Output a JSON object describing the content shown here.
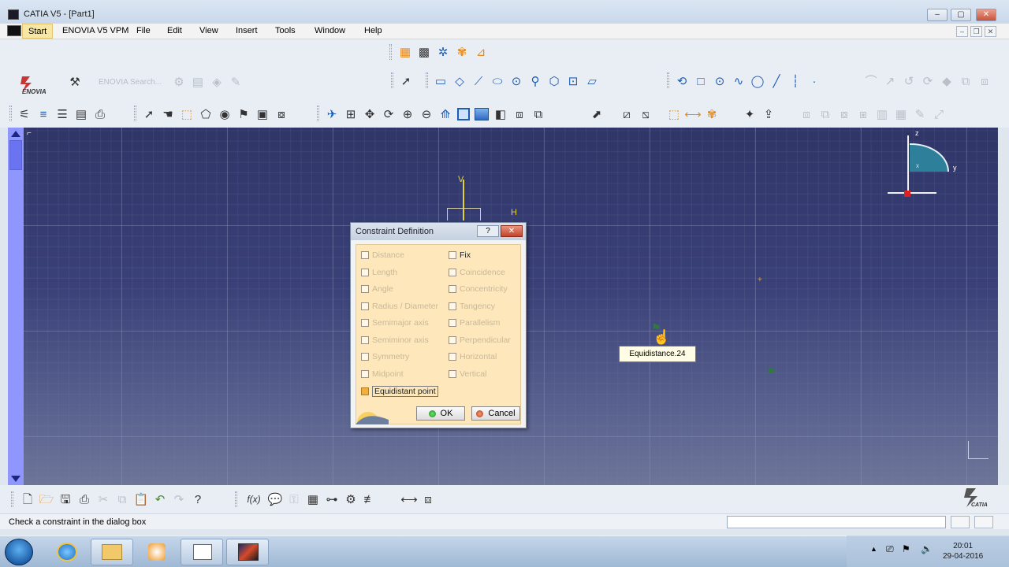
{
  "window": {
    "title": "CATIA V5 - [Part1]",
    "controls": [
      "minimize",
      "maximize",
      "close"
    ]
  },
  "menu": {
    "items": [
      "Start",
      "ENOVIA V5 VPM",
      "File",
      "Edit",
      "View",
      "Insert",
      "Tools",
      "Window",
      "Help"
    ]
  },
  "toolbar": {
    "enovia_logo_text": "ENOVIA",
    "enovia_search": "ENOVIA Search..."
  },
  "viewport": {
    "background": "#3a4178",
    "grid": true,
    "axis_labels": {
      "v": "V",
      "h": "H",
      "z": "z",
      "y": "y",
      "x": "x"
    }
  },
  "dialog": {
    "title": "Constraint Definition",
    "help": "?",
    "left_options": [
      {
        "label": "Distance",
        "enabled": false,
        "checked": false
      },
      {
        "label": "Length",
        "enabled": false,
        "checked": false
      },
      {
        "label": "Angle",
        "enabled": false,
        "checked": false
      },
      {
        "label": "Radius / Diameter",
        "enabled": false,
        "checked": false
      },
      {
        "label": "Semimajor axis",
        "enabled": false,
        "checked": false
      },
      {
        "label": "Semiminor axis",
        "enabled": false,
        "checked": false
      },
      {
        "label": "Symmetry",
        "enabled": false,
        "checked": false
      },
      {
        "label": "Midpoint",
        "enabled": false,
        "checked": false
      },
      {
        "label": "Equidistant point",
        "enabled": true,
        "checked": true
      }
    ],
    "right_options": [
      {
        "label": "Fix",
        "enabled": true,
        "checked": false
      },
      {
        "label": "Coincidence",
        "enabled": false,
        "checked": false
      },
      {
        "label": "Concentricity",
        "enabled": false,
        "checked": false
      },
      {
        "label": "Tangency",
        "enabled": false,
        "checked": false
      },
      {
        "label": "Parallelism",
        "enabled": false,
        "checked": false
      },
      {
        "label": "Perpendicular",
        "enabled": false,
        "checked": false
      },
      {
        "label": "Horizontal",
        "enabled": false,
        "checked": false
      },
      {
        "label": "Vertical",
        "enabled": false,
        "checked": false
      }
    ],
    "ok_label": "OK",
    "cancel_label": "Cancel"
  },
  "tooltip": {
    "text": "Equidistance.24"
  },
  "status": {
    "message": "Check a constraint in the dialog box",
    "input_value": ""
  },
  "bottom_toolbar": {
    "fx_label": "f(x)",
    "catia_logo_text": "CATIA"
  },
  "taskbar": {
    "time": "20:01",
    "date": "29-04-2016"
  }
}
